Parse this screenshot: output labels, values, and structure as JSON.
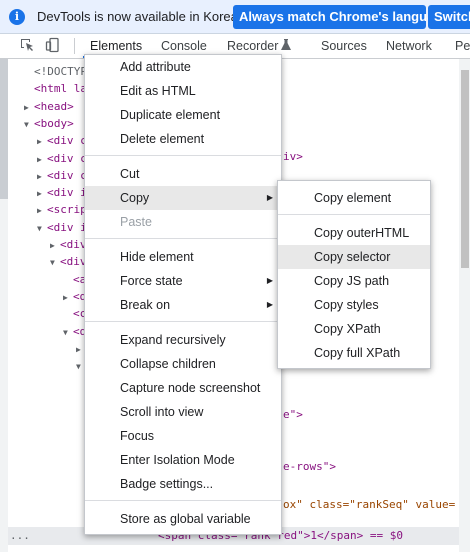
{
  "infobar": {
    "icon": "info-icon",
    "message": "DevTools is now available in Korean!",
    "match_button": "Always match Chrome's language",
    "switch_button": "Switch"
  },
  "toolbar": {
    "tabs": [
      "Elements",
      "Console",
      "Recorder",
      "Sources",
      "Network",
      "Perf"
    ]
  },
  "tree": {
    "lines": [
      {
        "indent": 24,
        "tri": "",
        "html": "<!DOCTYPE"
      },
      {
        "indent": 24,
        "tri": "",
        "html": "<html lan"
      },
      {
        "indent": 24,
        "tri": "▶",
        "html": "<head>"
      },
      {
        "indent": 24,
        "tri": "▼",
        "html": "<body>"
      },
      {
        "indent": 37,
        "tri": "▶",
        "html": "<div c"
      },
      {
        "indent": 37,
        "tri": "▶",
        "html": "<div c"
      },
      {
        "indent": 37,
        "tri": "▶",
        "html": "<div c"
      },
      {
        "indent": 37,
        "tri": "▶",
        "html": "<div i"
      },
      {
        "indent": 37,
        "tri": "▶",
        "html": "<scrip"
      },
      {
        "indent": 37,
        "tri": "▼",
        "html": "<div i"
      },
      {
        "indent": 50,
        "tri": "▶",
        "html": "<div"
      },
      {
        "indent": 50,
        "tri": "▼",
        "html": "<div"
      },
      {
        "indent": 63,
        "tri": "",
        "html": "<a"
      },
      {
        "indent": 63,
        "tri": "▶",
        "html": "<d"
      },
      {
        "indent": 63,
        "tri": "",
        "html": "<c"
      },
      {
        "indent": 63,
        "tri": "▼",
        "html": "<d"
      },
      {
        "indent": 76,
        "tri": "▶",
        "html": ""
      },
      {
        "indent": 76,
        "tri": "▼",
        "html": ""
      }
    ],
    "right_fragments": {
      "div_close": "iv>",
      "e_close": "e\">",
      "rows": "e-rows\">",
      "checkbox": "ox\" class=\"rankSeq\" value=",
      "bottom_line": "<span class=\"rank red\">1</span> == $0"
    }
  },
  "context_menu": {
    "items": [
      {
        "label": "Add attribute",
        "submenu": false
      },
      {
        "label": "Edit as HTML",
        "submenu": false
      },
      {
        "label": "Duplicate element",
        "submenu": false
      },
      {
        "label": "Delete element",
        "submenu": false
      },
      {
        "sep": true
      },
      {
        "label": "Cut",
        "submenu": false
      },
      {
        "label": "Copy",
        "submenu": true,
        "highlighted": true
      },
      {
        "label": "Paste",
        "submenu": false,
        "disabled": true
      },
      {
        "sep": true
      },
      {
        "label": "Hide element",
        "submenu": false
      },
      {
        "label": "Force state",
        "submenu": true
      },
      {
        "label": "Break on",
        "submenu": true
      },
      {
        "sep": true
      },
      {
        "label": "Expand recursively",
        "submenu": false
      },
      {
        "label": "Collapse children",
        "submenu": false
      },
      {
        "label": "Capture node screenshot",
        "submenu": false
      },
      {
        "label": "Scroll into view",
        "submenu": false
      },
      {
        "label": "Focus",
        "submenu": false
      },
      {
        "label": "Enter Isolation Mode",
        "submenu": false
      },
      {
        "label": "Badge settings...",
        "submenu": false
      },
      {
        "sep": true
      },
      {
        "label": "Store as global variable",
        "submenu": false
      }
    ]
  },
  "copy_submenu": {
    "items": [
      {
        "label": "Copy element"
      },
      {
        "sep": true
      },
      {
        "label": "Copy outerHTML"
      },
      {
        "label": "Copy selector",
        "highlighted": true
      },
      {
        "label": "Copy JS path"
      },
      {
        "label": "Copy styles"
      },
      {
        "label": "Copy XPath"
      },
      {
        "label": "Copy full XPath"
      }
    ]
  },
  "colors": {
    "accent": "#1a73e8",
    "infobar_bg": "#e8f0fe",
    "highlight": "#e8e8e8"
  }
}
